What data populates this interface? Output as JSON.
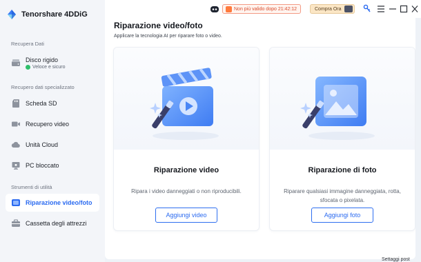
{
  "app": {
    "name": "Tenorshare 4DDiG"
  },
  "topbar": {
    "timer_text": "Non più valido dopo 21:42:12",
    "buy_label": "Compra Ora"
  },
  "sidebar": {
    "section_recover": "Recupera Dati",
    "disk_label": "Disco rigido",
    "disk_sub": "Veloce e sicuro",
    "section_special": "Recupero dati specializzato",
    "items_special": [
      {
        "label": "Scheda SD"
      },
      {
        "label": "Recupero video"
      },
      {
        "label": "Unità Cloud"
      },
      {
        "label": "PC bloccato"
      }
    ],
    "section_tools": "Strumenti di utilità",
    "items_tools": [
      {
        "label": "Riparazione video/foto"
      },
      {
        "label": "Cassetta degli attrezzi"
      }
    ]
  },
  "main": {
    "title": "Riparazione video/foto",
    "subtitle": "Applicare la tecnologia AI per riparare foto o video.",
    "cards": [
      {
        "title": "Riparazione video",
        "desc": "Ripara i video danneggiati o non riproducibili.",
        "button": "Aggiungi video"
      },
      {
        "title": "Riparazione di foto",
        "desc": "Riparare qualsiasi immagine danneggiata, rotta, sfocata o pixelata.",
        "button": "Aggiungi foto"
      }
    ]
  },
  "footer": {
    "text": "Settaggi post"
  },
  "colors": {
    "accent": "#2a6af0",
    "sidebar_bg": "#f3f5f9",
    "warning": "#d94b2b"
  }
}
